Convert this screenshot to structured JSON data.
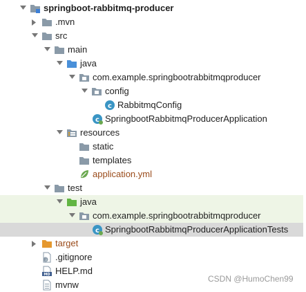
{
  "tree": {
    "root": {
      "label": "springboot-rabbitmq-producer",
      "icon": "module-folder-icon"
    },
    "mvn": {
      "label": ".mvn",
      "icon": "folder-icon"
    },
    "src": {
      "label": "src",
      "icon": "folder-icon"
    },
    "main": {
      "label": "main",
      "icon": "folder-icon"
    },
    "main_java": {
      "label": "java",
      "icon": "source-root-icon"
    },
    "main_package": {
      "label": "com.example.springbootrabbitmqproducer",
      "icon": "package-icon"
    },
    "config": {
      "label": "config",
      "icon": "package-icon"
    },
    "rabbitmq_config": {
      "label": "RabbitmqConfig",
      "icon": "java-class-icon"
    },
    "app_class": {
      "label": "SpringbootRabbitmqProducerApplication",
      "icon": "spring-boot-class-icon"
    },
    "resources": {
      "label": "resources",
      "icon": "resources-folder-icon"
    },
    "static": {
      "label": "static",
      "icon": "folder-icon"
    },
    "templates": {
      "label": "templates",
      "icon": "folder-icon"
    },
    "application_yml": {
      "label": "application.yml",
      "icon": "spring-yml-icon"
    },
    "test": {
      "label": "test",
      "icon": "folder-icon"
    },
    "test_java": {
      "label": "java",
      "icon": "test-source-root-icon"
    },
    "test_package": {
      "label": "com.example.springbootrabbitmqproducer",
      "icon": "package-icon"
    },
    "test_class": {
      "label": "SpringbootRabbitmqProducerApplicationTests",
      "icon": "spring-boot-class-icon"
    },
    "target": {
      "label": "target",
      "icon": "excluded-folder-icon"
    },
    "gitignore": {
      "label": ".gitignore",
      "icon": "gitignore-file-icon"
    },
    "help_md": {
      "label": "HELP.md",
      "icon": "markdown-file-icon"
    },
    "mvnw": {
      "label": "mvnw",
      "icon": "text-file-icon"
    }
  },
  "watermark": "CSDN @HumoChen99",
  "colors": {
    "folder": "#8a9aa8",
    "source_root": "#4a90d9",
    "test_root": "#62b543",
    "excluded": "#e5982f",
    "class_circle": "#3a95c4",
    "spring_green": "#6aa84f",
    "selected_row": "#d9d9d9",
    "test_row": "#eef5e6",
    "file_green_text": "#357a1b",
    "file_brown_text": "#9a4b1a"
  }
}
